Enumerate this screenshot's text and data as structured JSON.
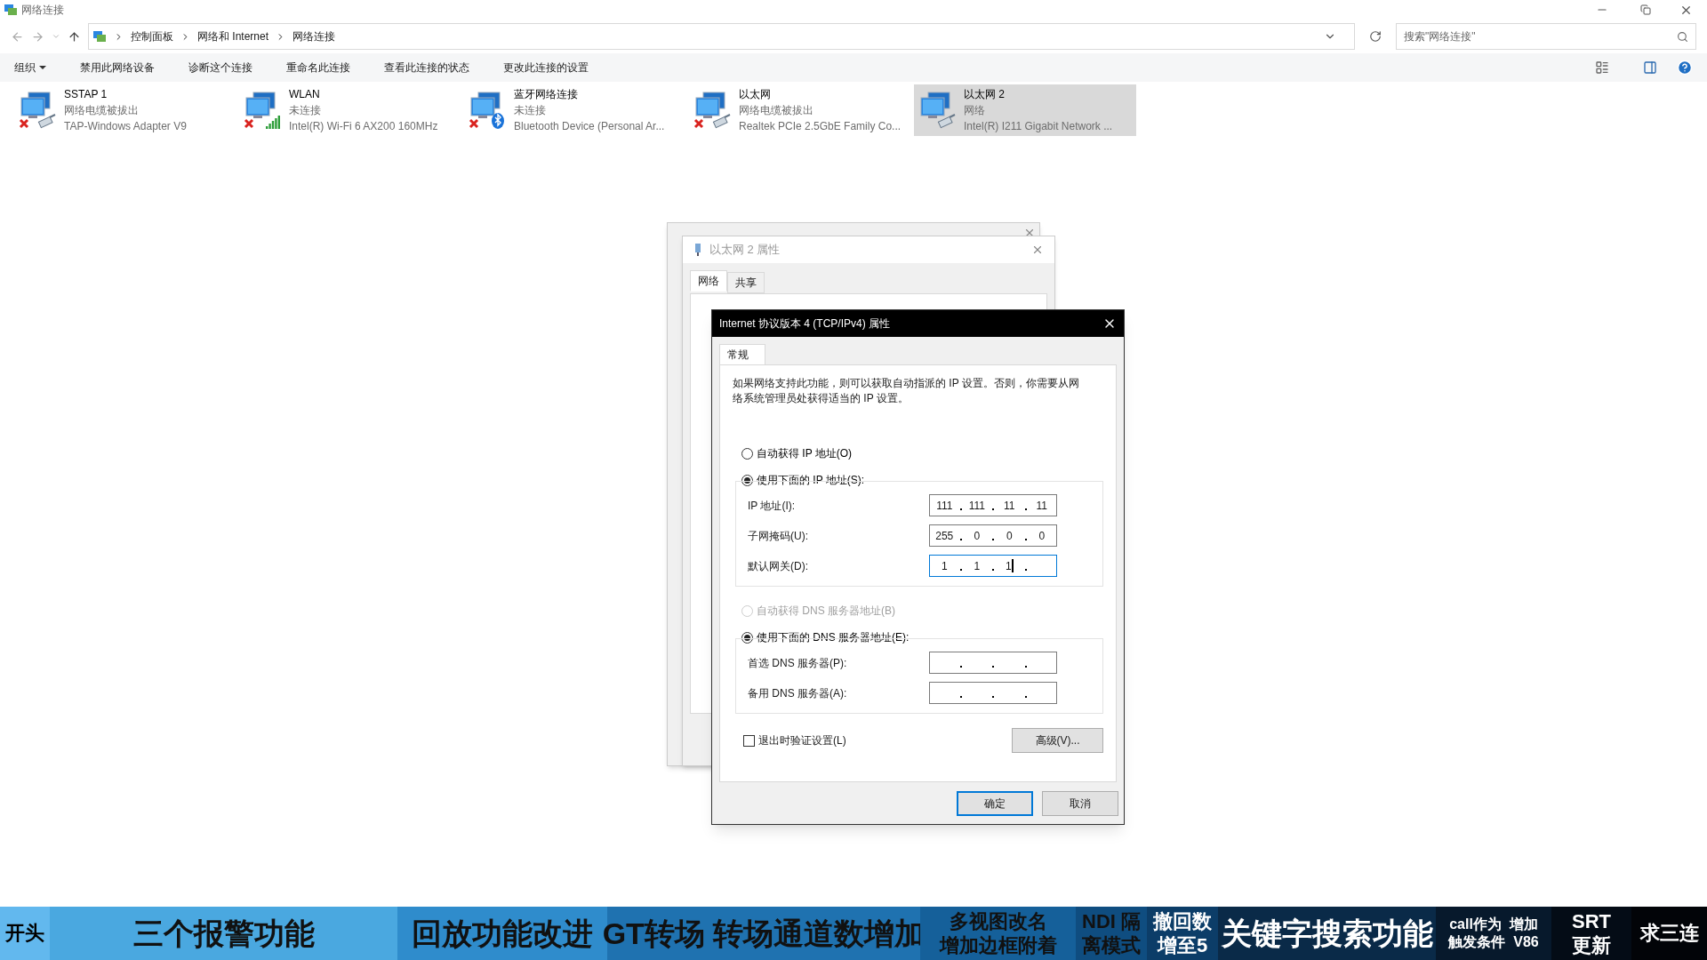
{
  "window": {
    "title": "网络连接"
  },
  "address": {
    "crumbs": [
      "控制面板",
      "网络和 Internet",
      "网络连接"
    ],
    "search_placeholder": "搜索\"网络连接\""
  },
  "toolbar": {
    "organize": "组织",
    "actions": [
      "禁用此网络设备",
      "诊断这个连接",
      "重命名此连接",
      "查看此连接的状态",
      "更改此连接的设置"
    ]
  },
  "connections": [
    {
      "name": "SSTAP 1",
      "status": "网络电缆被拔出",
      "adapter": "TAP-Windows Adapter V9",
      "kind": "cable",
      "error": true,
      "selected": false
    },
    {
      "name": "WLAN",
      "status": "未连接",
      "adapter": "Intel(R) Wi-Fi 6 AX200 160MHz",
      "kind": "wifi",
      "error": true,
      "selected": false
    },
    {
      "name": "蓝牙网络连接",
      "status": "未连接",
      "adapter": "Bluetooth Device (Personal Ar...",
      "kind": "bluetooth",
      "error": true,
      "selected": false
    },
    {
      "name": "以太网",
      "status": "网络电缆被拔出",
      "adapter": "Realtek PCIe 2.5GbE Family Co...",
      "kind": "cable",
      "error": true,
      "selected": false
    },
    {
      "name": "以太网 2",
      "status": "网络",
      "adapter": "Intel(R) I211 Gigabit Network ...",
      "kind": "cable",
      "error": false,
      "selected": true
    }
  ],
  "properties_window": {
    "title": "以太网 2 属性",
    "tabs": [
      {
        "label": "网络",
        "selected": true
      },
      {
        "label": "共享",
        "selected": false
      }
    ]
  },
  "ipv4_dialog": {
    "title": "Internet 协议版本 4 (TCP/IPv4) 属性",
    "tab": "常规",
    "description": "如果网络支持此功能，则可以获取自动指派的 IP 设置。否则，你需要从网络系统管理员处获得适当的 IP 设置。",
    "ip_radios": [
      {
        "label": "自动获得 IP 地址(O)",
        "selected": false,
        "disabled": false
      },
      {
        "label": "使用下面的 IP 地址(S):",
        "selected": true,
        "disabled": false
      }
    ],
    "ip_fields": [
      {
        "label": "IP 地址(I):",
        "octets": [
          "111",
          "111",
          "11",
          "11"
        ],
        "focused": false
      },
      {
        "label": "子网掩码(U):",
        "octets": [
          "255",
          "0",
          "0",
          "0"
        ],
        "focused": false
      },
      {
        "label": "默认网关(D):",
        "octets": [
          "1",
          "1",
          "1"
        ],
        "focused": true
      }
    ],
    "dns_radios": [
      {
        "label": "自动获得 DNS 服务器地址(B)",
        "selected": false,
        "disabled": true
      },
      {
        "label": "使用下面的 DNS 服务器地址(E):",
        "selected": true,
        "disabled": false
      }
    ],
    "dns_fields": [
      {
        "label": "首选 DNS 服务器(P):"
      },
      {
        "label": "备用 DNS 服务器(A):"
      }
    ],
    "validate": {
      "label": "退出时验证设置(L)",
      "checked": false
    },
    "advanced": "高级(V)...",
    "buttons": [
      {
        "label": "确定",
        "default": true
      },
      {
        "label": "取消",
        "default": false
      }
    ]
  },
  "chapters": [
    {
      "lines": [
        "开头"
      ],
      "color": "#62b8ee"
    },
    {
      "lines": [
        "三个报警功能"
      ],
      "color": "#4aa8e0"
    },
    {
      "lines": [
        "回放功能改进"
      ],
      "color": "#2f8ccc"
    },
    {
      "lines": [
        "GT转场 转场通道数增加"
      ],
      "color": "#1f72b0"
    },
    {
      "lines": [
        "多视图改名",
        "增加边框附着"
      ],
      "color": "#15609a"
    },
    {
      "lines": [
        "NDI 隔",
        "离模式"
      ],
      "color": "#0f4d80"
    },
    {
      "lines": [
        "撤回数",
        "增至5"
      ],
      "color": "#0c3d68"
    },
    {
      "lines": [
        "关键字搜索功能"
      ],
      "color": "#0a2a48"
    },
    {
      "lines": [
        "call作为  增加",
        "触发条件  V86"
      ],
      "color": "#07192c"
    },
    {
      "lines": [
        "SRT",
        "更新"
      ],
      "color": "#040c16"
    },
    {
      "lines": [
        "求三连"
      ],
      "color": "#020408"
    }
  ]
}
